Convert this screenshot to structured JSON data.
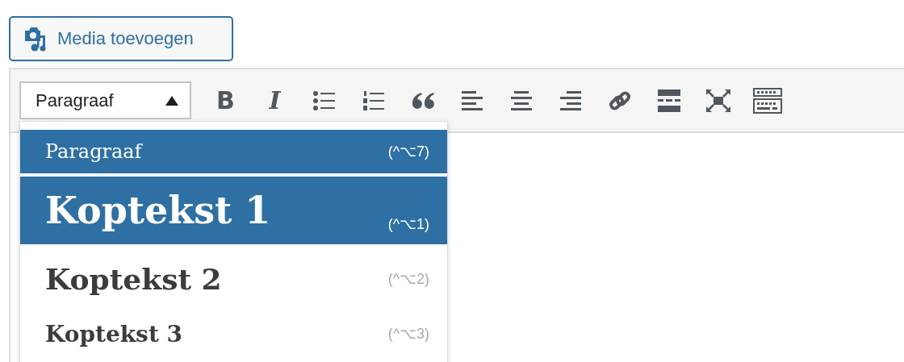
{
  "media_button": {
    "label": "Media toevoegen"
  },
  "format_select": {
    "value": "Paragraaf",
    "expanded": true
  },
  "toolbar": [
    {
      "kind": "bold",
      "label": "B"
    },
    {
      "kind": "italic",
      "label": "I"
    },
    {
      "kind": "bullet-list"
    },
    {
      "kind": "numbered-list"
    },
    {
      "kind": "quote"
    },
    {
      "kind": "align-left"
    },
    {
      "kind": "align-center"
    },
    {
      "kind": "align-right"
    },
    {
      "kind": "link"
    },
    {
      "kind": "more"
    },
    {
      "kind": "fullscreen"
    },
    {
      "kind": "toolbar-toggle"
    }
  ],
  "format_menu": [
    {
      "kind": "paragraph",
      "label": "Paragraaf",
      "shortcut": "(^⌥7)",
      "highlighted": true
    },
    {
      "kind": "h1",
      "label": "Koptekst 1",
      "shortcut": "(^⌥1)",
      "highlighted": true
    },
    {
      "kind": "h2",
      "label": "Koptekst 2",
      "shortcut": "(^⌥2)",
      "highlighted": false
    },
    {
      "kind": "h3",
      "label": "Koptekst 3",
      "shortcut": "(^⌥3)",
      "highlighted": false
    }
  ]
}
